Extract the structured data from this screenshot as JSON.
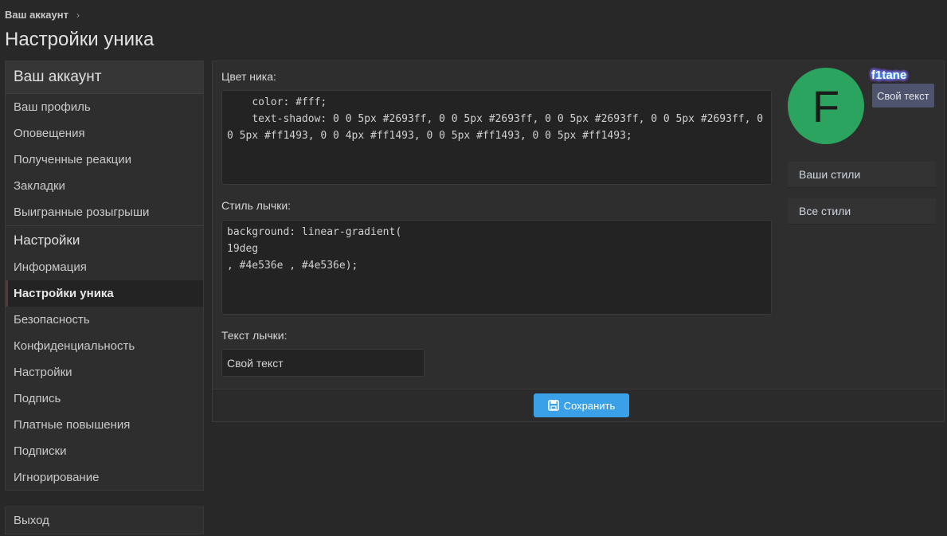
{
  "breadcrumb": {
    "label": "Ваш аккаунт",
    "chevron": "›"
  },
  "page": {
    "title": "Настройки уника"
  },
  "sidebar": {
    "header": "Ваш аккаунт",
    "account_items": [
      {
        "label": "Ваш профиль"
      },
      {
        "label": "Оповещения"
      },
      {
        "label": "Полученные реакции"
      },
      {
        "label": "Закладки"
      },
      {
        "label": "Выигранные розыгрыши"
      }
    ],
    "settings_header": "Настройки",
    "settings_items": [
      {
        "label": "Информация"
      },
      {
        "label": "Настройки уника",
        "active": true
      },
      {
        "label": "Безопасность"
      },
      {
        "label": "Конфиденциальность"
      },
      {
        "label": "Настройки"
      },
      {
        "label": "Подпись"
      },
      {
        "label": "Платные повышения"
      },
      {
        "label": "Подписки"
      },
      {
        "label": "Игнорирование"
      }
    ],
    "logout": "Выход"
  },
  "form": {
    "nick_color_label": "Цвет ника:",
    "nick_color_value": "    color: #fff;\n    text-shadow: 0 0 5px #2693ff, 0 0 5px #2693ff, 0 0 5px #2693ff, 0 0 5px #2693ff, 0 0 5px #ff1493, 0 0 4px #ff1493, 0 0 5px #ff1493, 0 0 5px #ff1493;",
    "badge_style_label": "Стиль лычки:",
    "badge_style_value": "background: linear-gradient(\n19deg\n, #4e536e , #4e536e);",
    "badge_text_label": "Текст лычки:",
    "badge_text_value": "Свой текст",
    "save_label": "Сохранить",
    "save_icon": "floppy-disk-icon"
  },
  "preview": {
    "avatar_letter": "F",
    "nickname": "f1tane",
    "badge_text": "Свой текст",
    "colors": {
      "avatar_bg": "#2aa45e",
      "badge_bg": "#4e536e",
      "accent": "#3aa1e8"
    }
  },
  "style_links": [
    {
      "label": "Ваши стили"
    },
    {
      "label": "Все стили"
    }
  ]
}
